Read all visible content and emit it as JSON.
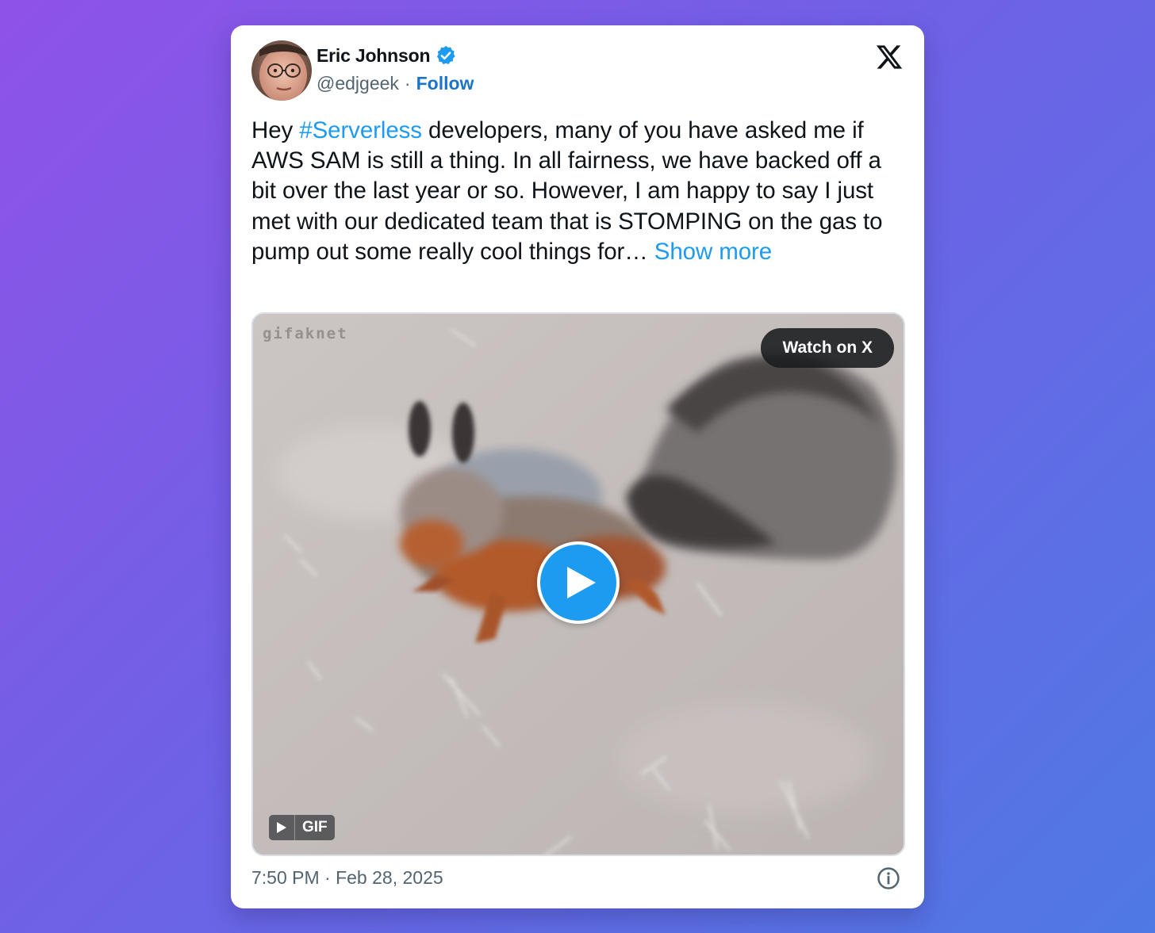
{
  "tweet": {
    "author": {
      "name": "Eric Johnson",
      "handle": "@edjgeek",
      "separator": "·",
      "follow_label": "Follow",
      "verified": true
    },
    "platform_icon": "x-logo-icon",
    "text": {
      "before": "Hey ",
      "hashtag": "#Serverless",
      "after": " developers, many of you have asked me if AWS SAM is still a thing. In all fairness, we have backed off a bit over the last year or so. However, I am happy to say I just met with our dedicated team that is STOMPING on the gas to pump out some really cool things for… ",
      "show_more": "Show more"
    },
    "media": {
      "watermark": "gifaknet",
      "watch_label": "Watch on X",
      "play_icon": "play-icon",
      "gif_label": "GIF"
    },
    "timestamp": "7:50 PM · Feb 28, 2025",
    "info_icon": "info-icon"
  },
  "colors": {
    "link": "#1d9bf0",
    "follow": "#1b74c9",
    "text": "#0f1419",
    "muted": "#536471",
    "card": "#ffffff"
  }
}
